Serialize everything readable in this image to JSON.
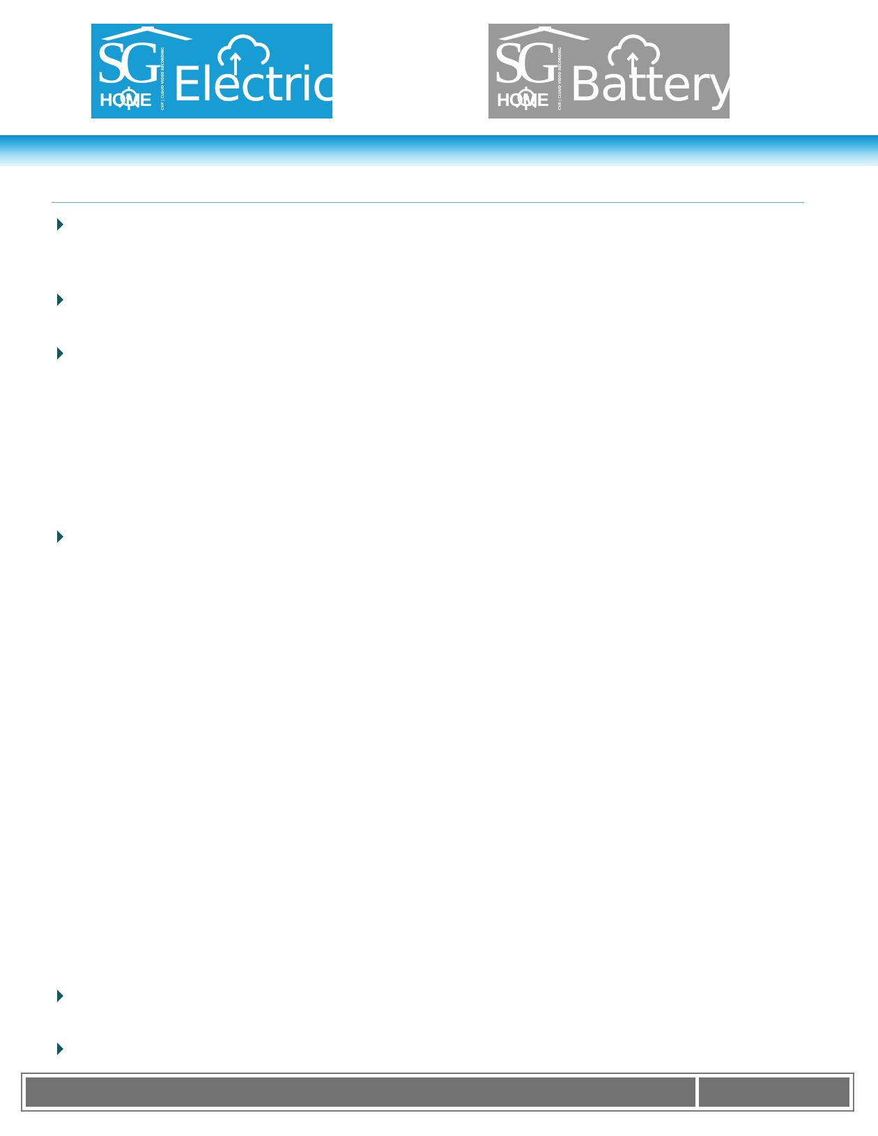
{
  "colors": {
    "electric_logo_bg": "#179dd4",
    "battery_logo_bg": "#999999",
    "header_band_top": "#0d8ccc",
    "header_band_bottom": "#e4f6fd",
    "divider": "#5fb4cc",
    "bullet": "#0f5a5f",
    "footer_fill": "#737373"
  },
  "logos": {
    "electric": {
      "brand_initials": "SG",
      "brand_home": "HOME",
      "tagline": "CVR | CLOUD VIDEO RECORDING",
      "product": "Electric",
      "icons": [
        "house-roof-icon",
        "cloud-upload-icon",
        "camera-lens-icon"
      ]
    },
    "battery": {
      "brand_initials": "SG",
      "brand_home": "HOME",
      "tagline": "CVR | CLOUD VIDEO RECORDING",
      "product": "Battery",
      "icons": [
        "house-roof-icon",
        "cloud-upload-icon",
        "camera-lens-icon"
      ]
    }
  },
  "bullets": {
    "icon": "triangle-right-icon",
    "items": [
      "",
      "",
      "",
      "",
      "",
      ""
    ]
  },
  "footer": {
    "left_text": "",
    "right_text": ""
  }
}
